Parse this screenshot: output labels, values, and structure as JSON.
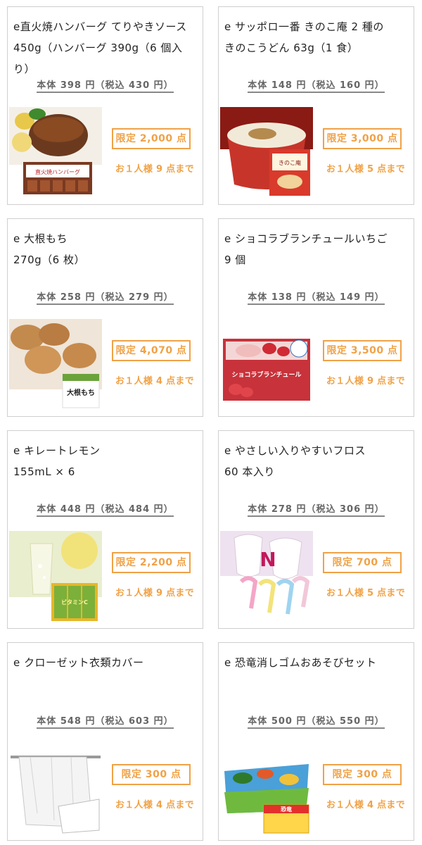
{
  "products": [
    {
      "title": "e直火焼ハンバーグ てりやきソース\n450g（ハンバーグ 390g（6 個入り）",
      "price": "本体 398 円（税込 430 円）",
      "limit": "限定 2,000 点",
      "per_user": "お１人様 9 点まで",
      "image": "hamburg-steak-image",
      "package_text": "直火焼ハンバーグ"
    },
    {
      "title": "e サッポロ一番 きのこ庵 2 種の\nきのこうどん 63g（1 食）",
      "price": "本体 148 円（税込 160 円）",
      "limit": "限定 3,000 点",
      "per_user": "お１人様 5 点まで",
      "image": "mushroom-udon-cup-image",
      "package_text": "きのこ庵"
    },
    {
      "title": "e 大根もち\n270g（6 枚）",
      "price": "本体 258 円（税込 279 円）",
      "limit": "限定 4,070 点",
      "per_user": "お１人様 4 点まで",
      "image": "daikon-mochi-image",
      "package_text": "大根もち"
    },
    {
      "title": "e ショコラブランチュールいちご\n9 個",
      "price": "本体 138 円（税込 149 円）",
      "limit": "限定 3,500 点",
      "per_user": "お１人様 9 点まで",
      "image": "chocolat-blanchur-strawberry-image",
      "package_text": "ショコラブランチュール"
    },
    {
      "title": "e キレートレモン\n155mL × 6",
      "price": "本体 448 円（税込 484 円）",
      "limit": "限定 2,200 点",
      "per_user": "お１人様 9 点まで",
      "image": "kireto-lemon-drink-image",
      "package_text": "ビタミンC"
    },
    {
      "title": "e やさしい入りやすいフロス\n60 本入り",
      "price": "本体 278 円（税込 306 円）",
      "limit": "限定 700 点",
      "per_user": "お１人様 5 点まで",
      "image": "dental-floss-image",
      "package_text": "N"
    },
    {
      "title": "e クローゼット衣類カバー",
      "price": "本体 548 円（税込 603 円）",
      "limit": "限定 300 点",
      "per_user": "お１人様 4 点まで",
      "image": "closet-clothes-cover-image",
      "package_text": ""
    },
    {
      "title": "e 恐竜消しゴムおあそびセット",
      "price": "本体 500 円（税込 550 円）",
      "limit": "限定 300 点",
      "per_user": "お１人様 4 点まで",
      "image": "dinosaur-eraser-set-image",
      "package_text": "恐竜"
    }
  ],
  "colors": {
    "accent": "#f0a247",
    "border": "#cfcfcf",
    "price_text": "#666666"
  }
}
